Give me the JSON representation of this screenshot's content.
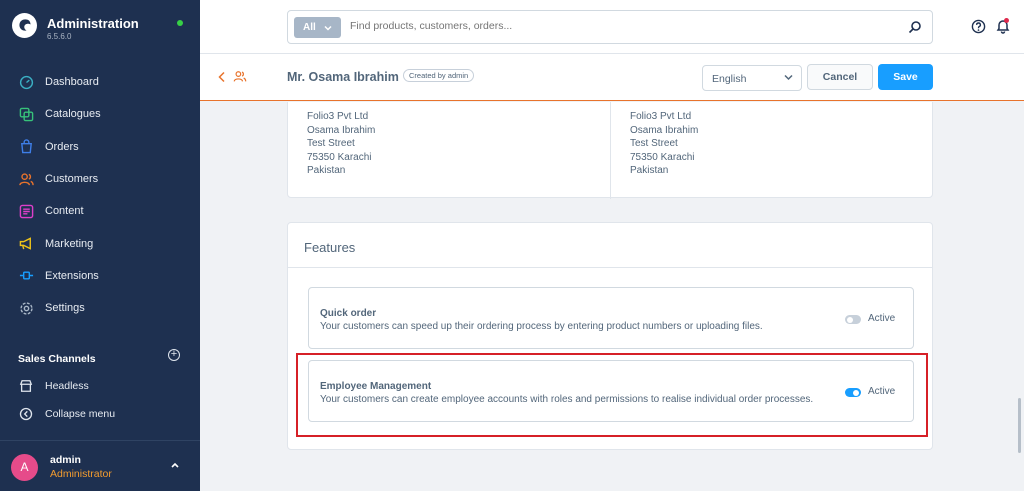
{
  "app": {
    "title": "Administration",
    "version": "6.5.6.0"
  },
  "sidebar": {
    "items": [
      {
        "label": "Dashboard",
        "icon": "dashboard-icon",
        "color": "#3bb0c4"
      },
      {
        "label": "Catalogues",
        "icon": "catalogue-icon",
        "color": "#37c27a"
      },
      {
        "label": "Orders",
        "icon": "orders-icon",
        "color": "#3e7ee8"
      },
      {
        "label": "Customers",
        "icon": "customers-icon",
        "color": "#e8732c"
      },
      {
        "label": "Content",
        "icon": "content-icon",
        "color": "#dd3fc9"
      },
      {
        "label": "Marketing",
        "icon": "marketing-icon",
        "color": "#f0c419"
      },
      {
        "label": "Extensions",
        "icon": "extensions-icon",
        "color": "#189eff"
      },
      {
        "label": "Settings",
        "icon": "settings-icon",
        "color": "#a9b7c7"
      }
    ],
    "sales_channels_title": "Sales Channels",
    "headless_label": "Headless",
    "collapse_label": "Collapse menu"
  },
  "user": {
    "initial": "A",
    "name": "admin",
    "role": "Administrator"
  },
  "search": {
    "scope": "All",
    "placeholder": "Find products, customers, orders..."
  },
  "smartbar": {
    "title": "Mr. Osama Ibrahim",
    "badge": "Created by admin",
    "language": "English",
    "cancel_label": "Cancel",
    "save_label": "Save"
  },
  "addresses": [
    {
      "lines": [
        "Folio3 Pvt Ltd",
        "Osama Ibrahim",
        "Test Street",
        "75350 Karachi",
        "Pakistan"
      ]
    },
    {
      "lines": [
        "Folio3 Pvt Ltd",
        "Osama Ibrahim",
        "Test Street",
        "75350 Karachi",
        "Pakistan"
      ]
    }
  ],
  "features": {
    "title": "Features",
    "items": [
      {
        "title": "Quick order",
        "description": "Your customers can speed up their ordering process by entering product numbers or uploading files.",
        "toggle_label": "Active",
        "active": false
      },
      {
        "title": "Employee Management",
        "description": "Your customers can create employee accounts with roles and permissions to realise individual order processes.",
        "toggle_label": "Active",
        "active": true
      }
    ]
  },
  "colors": {
    "accent": "#189eff",
    "sidebar_bg": "#1e3050",
    "highlight": "#d62027",
    "toggle_on": "#189eff",
    "toggle_off": "#c7d0da"
  }
}
